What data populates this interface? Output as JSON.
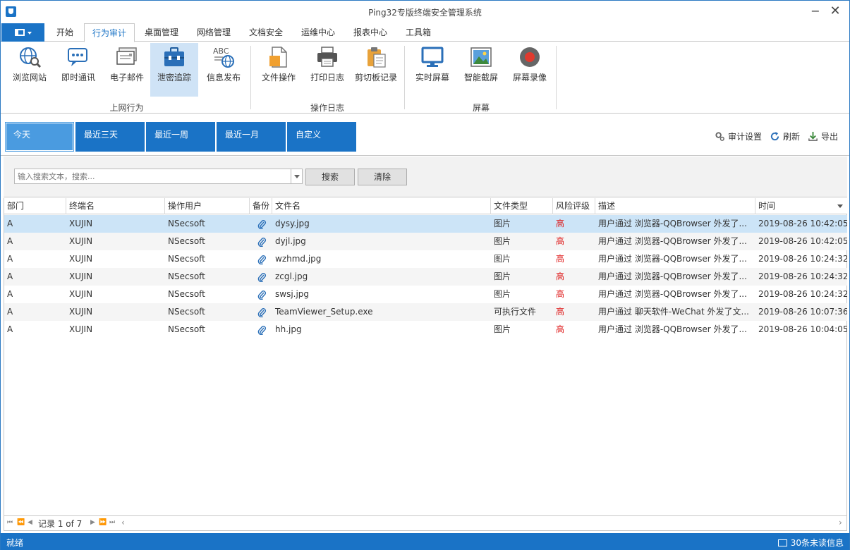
{
  "window": {
    "title": "Ping32专版终端安全管理系统",
    "minimize": "−",
    "close": "✕"
  },
  "menu": {
    "tabs": [
      {
        "label": "开始"
      },
      {
        "label": "行为审计"
      },
      {
        "label": "桌面管理"
      },
      {
        "label": "网络管理"
      },
      {
        "label": "文档安全"
      },
      {
        "label": "运维中心"
      },
      {
        "label": "报表中心"
      },
      {
        "label": "工具箱"
      }
    ],
    "active_tab": "行为审计"
  },
  "ribbon": {
    "groups": [
      {
        "label": "上网行为",
        "buttons": [
          {
            "label": "浏览网站",
            "icon": "globe-search-icon"
          },
          {
            "label": "即时通讯",
            "icon": "chat-icon"
          },
          {
            "label": "电子邮件",
            "icon": "email-icon"
          },
          {
            "label": "泄密追踪",
            "icon": "briefcase-icon"
          },
          {
            "label": "信息发布",
            "icon": "abc-globe-icon"
          }
        ]
      },
      {
        "label": "操作日志",
        "buttons": [
          {
            "label": "文件操作",
            "icon": "file-icon"
          },
          {
            "label": "打印日志",
            "icon": "printer-icon"
          },
          {
            "label": "剪切板记录",
            "icon": "clipboard-icon"
          }
        ]
      },
      {
        "label": "屏幕",
        "buttons": [
          {
            "label": "实时屏幕",
            "icon": "monitor-icon"
          },
          {
            "label": "智能截屏",
            "icon": "picture-icon"
          },
          {
            "label": "屏幕录像",
            "icon": "record-icon"
          }
        ]
      }
    ],
    "selected_button": "泄密追踪"
  },
  "date_filter": {
    "tabs": [
      {
        "label": "今天"
      },
      {
        "label": "最近三天"
      },
      {
        "label": "最近一周"
      },
      {
        "label": "最近一月"
      },
      {
        "label": "自定义"
      }
    ],
    "active": "今天"
  },
  "tools": {
    "settings": "审计设置",
    "refresh": "刷新",
    "export": "导出"
  },
  "search": {
    "placeholder": "输入搜索文本，搜索...",
    "search_label": "搜索",
    "clear_label": "清除"
  },
  "grid": {
    "columns": [
      "部门",
      "终端名",
      "操作用户",
      "备份",
      "文件名",
      "文件类型",
      "风险评级",
      "描述",
      "时间"
    ],
    "rows": [
      {
        "dept": "A",
        "terminal": "XUJIN",
        "user": "NSecsoft",
        "file": "dysy.jpg",
        "type": "图片",
        "risk": "高",
        "desc": "用户通过 浏览器-QQBrowser 外发了...",
        "time": "2019-08-26 10:42:05"
      },
      {
        "dept": "A",
        "terminal": "XUJIN",
        "user": "NSecsoft",
        "file": "dyjl.jpg",
        "type": "图片",
        "risk": "高",
        "desc": "用户通过 浏览器-QQBrowser 外发了...",
        "time": "2019-08-26 10:42:05"
      },
      {
        "dept": "A",
        "terminal": "XUJIN",
        "user": "NSecsoft",
        "file": "wzhmd.jpg",
        "type": "图片",
        "risk": "高",
        "desc": "用户通过 浏览器-QQBrowser 外发了...",
        "time": "2019-08-26 10:24:32"
      },
      {
        "dept": "A",
        "terminal": "XUJIN",
        "user": "NSecsoft",
        "file": "zcgl.jpg",
        "type": "图片",
        "risk": "高",
        "desc": "用户通过 浏览器-QQBrowser 外发了...",
        "time": "2019-08-26 10:24:32"
      },
      {
        "dept": "A",
        "terminal": "XUJIN",
        "user": "NSecsoft",
        "file": "swsj.jpg",
        "type": "图片",
        "risk": "高",
        "desc": "用户通过 浏览器-QQBrowser 外发了...",
        "time": "2019-08-26 10:24:32"
      },
      {
        "dept": "A",
        "terminal": "XUJIN",
        "user": "NSecsoft",
        "file": "TeamViewer_Setup.exe",
        "type": "可执行文件",
        "risk": "高",
        "desc": "用户通过 聊天软件-WeChat 外发了文...",
        "time": "2019-08-26 10:07:36"
      },
      {
        "dept": "A",
        "terminal": "XUJIN",
        "user": "NSecsoft",
        "file": "hh.jpg",
        "type": "图片",
        "risk": "高",
        "desc": "用户通过 浏览器-QQBrowser 外发了...",
        "time": "2019-08-26 10:04:05"
      }
    ]
  },
  "pager": {
    "record_text": "记录 1 of 7",
    "first": "⏮",
    "prev_page": "⏪",
    "prev": "◀",
    "next": "▶",
    "next_page": "⏩",
    "last": "⏭",
    "scroll_left": "‹",
    "scroll_right": "›"
  },
  "status": {
    "text": "就绪",
    "unread": "30条未读信息"
  },
  "colors": {
    "accent": "#1a73c6",
    "selected_row": "#cce4f7",
    "risk_high": "#dd1111"
  }
}
